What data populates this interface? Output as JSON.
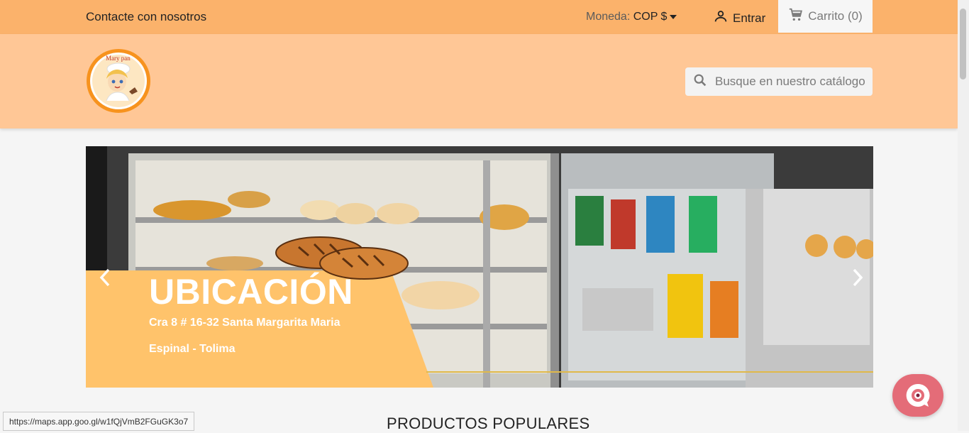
{
  "topbar": {
    "contact_label": "Contacte con nosotros",
    "currency_label": "Moneda:",
    "currency_value": "COP $",
    "login_label": "Entrar",
    "cart_label": "Carrito (0)"
  },
  "header": {
    "logo_text": "Mary pan",
    "search_placeholder": "Busque en nuestro catálogo"
  },
  "carousel": {
    "title": "UBICACIÓN",
    "line1": "Cra 8 # 16-32 Santa Margarita Maria",
    "line2": "Espinal - Tolima"
  },
  "products": {
    "section_title": "PRODUCTOS POPULARES"
  },
  "status": {
    "url": "https://maps.app.goo.gl/w1fQjVmB2FGuGK3o7"
  },
  "colors": {
    "topbar": "#fbb26b",
    "header": "#ffc796",
    "overlay": "#ffc36b",
    "chat": "#e46c78"
  },
  "icons": [
    "person-icon",
    "cart-icon",
    "search-icon",
    "chevron-left-icon",
    "chevron-right-icon",
    "chat-icon"
  ]
}
